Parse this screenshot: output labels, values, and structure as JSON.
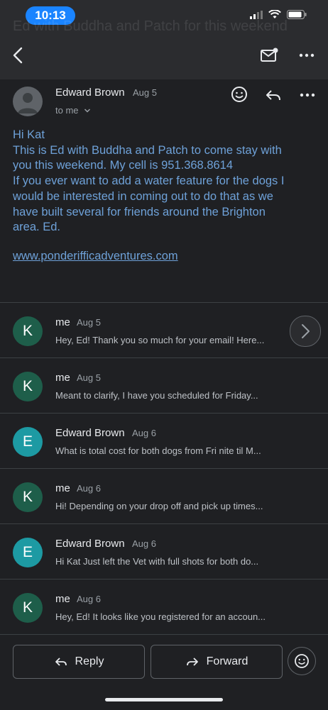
{
  "status": {
    "time": "10:13"
  },
  "header": {
    "ghost_subject": "Ed with Buddha and Patch for this weekend"
  },
  "message": {
    "sender": "Edward Brown",
    "date": "Aug 5",
    "to": "to me",
    "body_lines": [
      "Hi Kat",
      "This is Ed with Buddha and Patch to come stay with",
      "you this weekend.  My cell is  951.368.8614",
      "If you ever want to add a water feature for the dogs I",
      "would be interested in coming out to do that as we",
      "have built several for friends around the Brighton",
      "area.  Ed."
    ],
    "link": "www.ponderifficadventures.com"
  },
  "threads": [
    {
      "initial": "K",
      "name": "me",
      "date": "Aug 5",
      "snippet": "Hey, Ed! Thank you so much for your email! Here...",
      "color": "#1e5e4a"
    },
    {
      "initial": "K",
      "name": "me",
      "date": "Aug 5",
      "snippet": "Meant to clarify, I have you scheduled for Friday...",
      "color": "#1e5e4a"
    },
    {
      "initial": "E",
      "name": "Edward Brown",
      "date": "Aug 6",
      "snippet": "What is total cost for both dogs from Fri nite til M...",
      "color": "#1d9aa3"
    },
    {
      "initial": "K",
      "name": "me",
      "date": "Aug 6",
      "snippet": "Hi! Depending on your drop off and pick up times...",
      "color": "#1e5e4a"
    },
    {
      "initial": "E",
      "name": "Edward Brown",
      "date": "Aug 6",
      "snippet": "Hi Kat Just left the Vet with full shots for both do...",
      "color": "#1d9aa3"
    },
    {
      "initial": "K",
      "name": "me",
      "date": "Aug 6",
      "snippet": "Hey, Ed! It looks like you registered for an accoun...",
      "color": "#1e5e4a"
    }
  ],
  "actions": {
    "reply": "Reply",
    "forward": "Forward"
  },
  "icons": [
    "back-arrow-icon",
    "mark-unread-icon",
    "more-vert-icon",
    "emoji-icon",
    "reply-icon",
    "forward-icon",
    "chevron-right-icon"
  ]
}
